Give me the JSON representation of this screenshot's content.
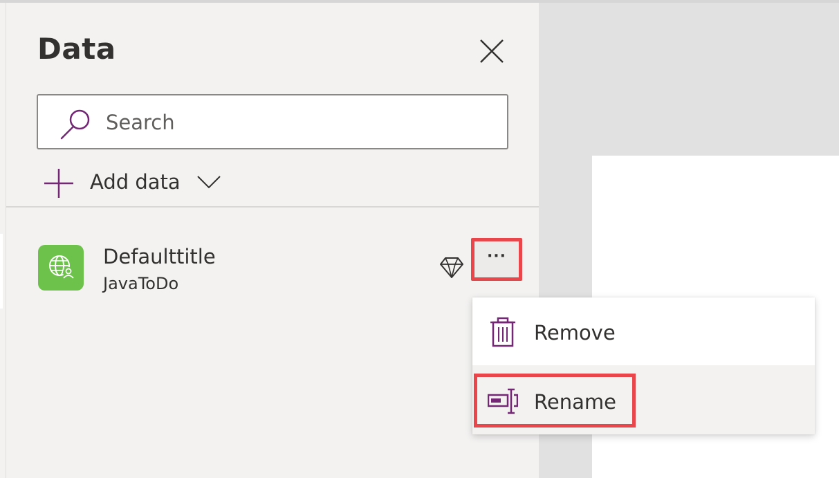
{
  "panel": {
    "title": "Data",
    "search": {
      "placeholder": "Search",
      "value": ""
    },
    "add_data_label": "Add data"
  },
  "data_sources": [
    {
      "name": "Defaulttitle",
      "subtitle": "JavaToDo",
      "icon": "globe-user-icon",
      "badge_icon": "premium-diamond-icon"
    }
  ],
  "more_button_label": "···",
  "context_menu": {
    "items": [
      {
        "label": "Remove",
        "icon": "trash-icon"
      },
      {
        "label": "Rename",
        "icon": "rename-icon"
      }
    ]
  },
  "colors": {
    "accent": "#742774",
    "datasource_icon_bg": "#6cc24a",
    "highlight": "#e8464a",
    "panel_bg": "#f3f2f1"
  }
}
